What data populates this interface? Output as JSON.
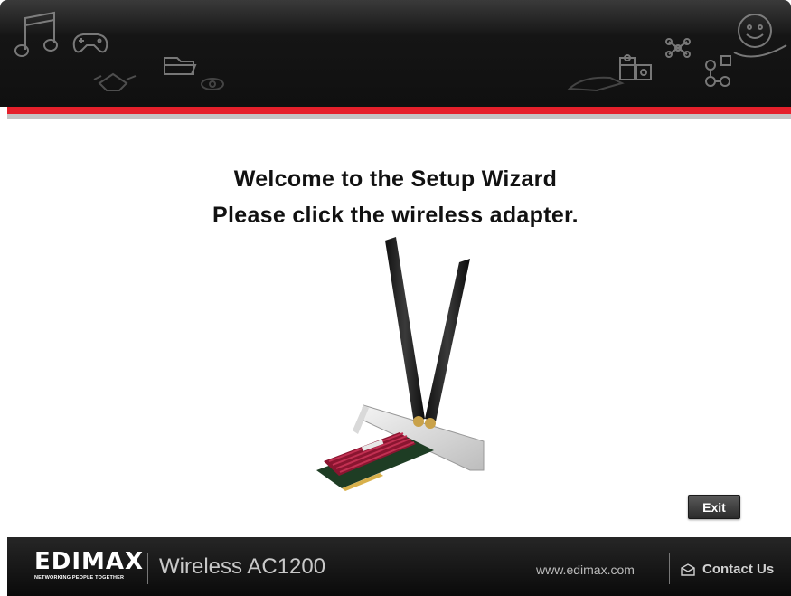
{
  "header": {
    "decor_icons": [
      "music-note-icon",
      "gamepad-icon",
      "handshake-icon",
      "folder-icon",
      "eye-icon",
      "hand-icon",
      "puzzle-icon",
      "network-icon",
      "smiley-icon",
      "molecule-icon"
    ]
  },
  "main": {
    "title_line1": "Welcome to the Setup Wizard",
    "title_line2": "Please click the wireless adapter.",
    "adapter_image": "wireless-adapter-image"
  },
  "buttons": {
    "exit_label": "Exit"
  },
  "footer": {
    "logo_text": "EDIMAX",
    "logo_tagline": "NETWORKING PEOPLE TOGETHER",
    "product_name": "Wireless AC1200",
    "website": "www.edimax.com",
    "contact_label": "Contact Us"
  },
  "colors": {
    "accent_red": "#e5202b",
    "header_dark": "#151515",
    "footer_dark": "#111111"
  }
}
